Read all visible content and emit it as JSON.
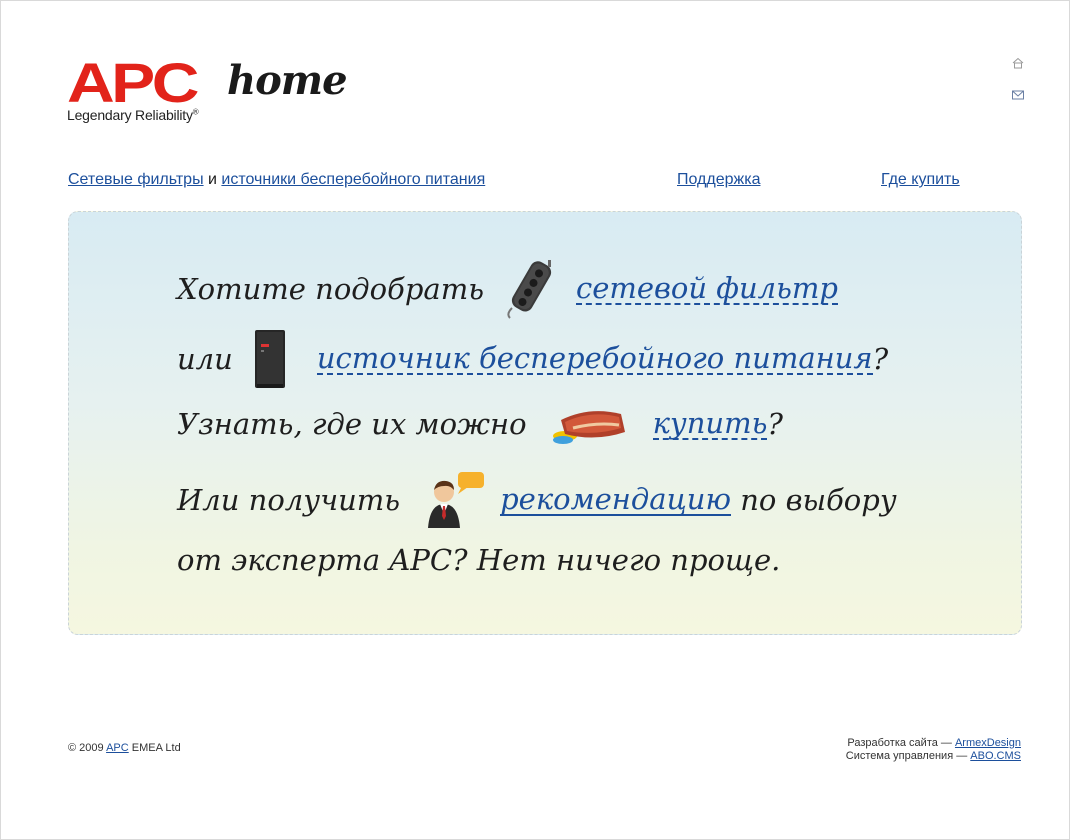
{
  "logo": {
    "brand": "APC",
    "product": "home",
    "tagline": "Legendary Reliability",
    "tagline_mark": "®",
    "brand_mark": "®"
  },
  "top_icons": {
    "home_icon": "home-icon",
    "mail_icon": "mail-icon"
  },
  "nav": {
    "filters_link": "Сетевые фильтры",
    "and_text": " и ",
    "ups_link": "источники бесперебойного питания",
    "support_link": "Поддержка",
    "where_link": "Где купить"
  },
  "hero": {
    "line1_text": "Хотите подобрать",
    "line1_link": "сетевой фильтр",
    "line2_text": "или",
    "line2_link": "источник бесперебойного питания",
    "line2_suffix": "?",
    "line3_text": "Узнать, где их можно",
    "line3_link": "купить",
    "line3_suffix": "?",
    "line4_text": "Или получить",
    "line4_link": "рекомендацию",
    "line4_suffix": " по выбору",
    "line5_text": "от эксперта APC? Нет ничего проще.",
    "icons": [
      "power-strip-icon",
      "ups-icon",
      "wallet-icon",
      "expert-icon"
    ]
  },
  "footer": {
    "copyright_prefix": "© 2009 ",
    "copyright_link": "APC",
    "copyright_suffix": " EMEA Ltd",
    "dev_prefix": "Разработка сайта — ",
    "dev_link": "ArmexDesign",
    "cms_prefix": "Система управления — ",
    "cms_link": "ABO.CMS"
  },
  "colors": {
    "brand_red": "#e2231a",
    "link_blue": "#1c4f9c"
  }
}
